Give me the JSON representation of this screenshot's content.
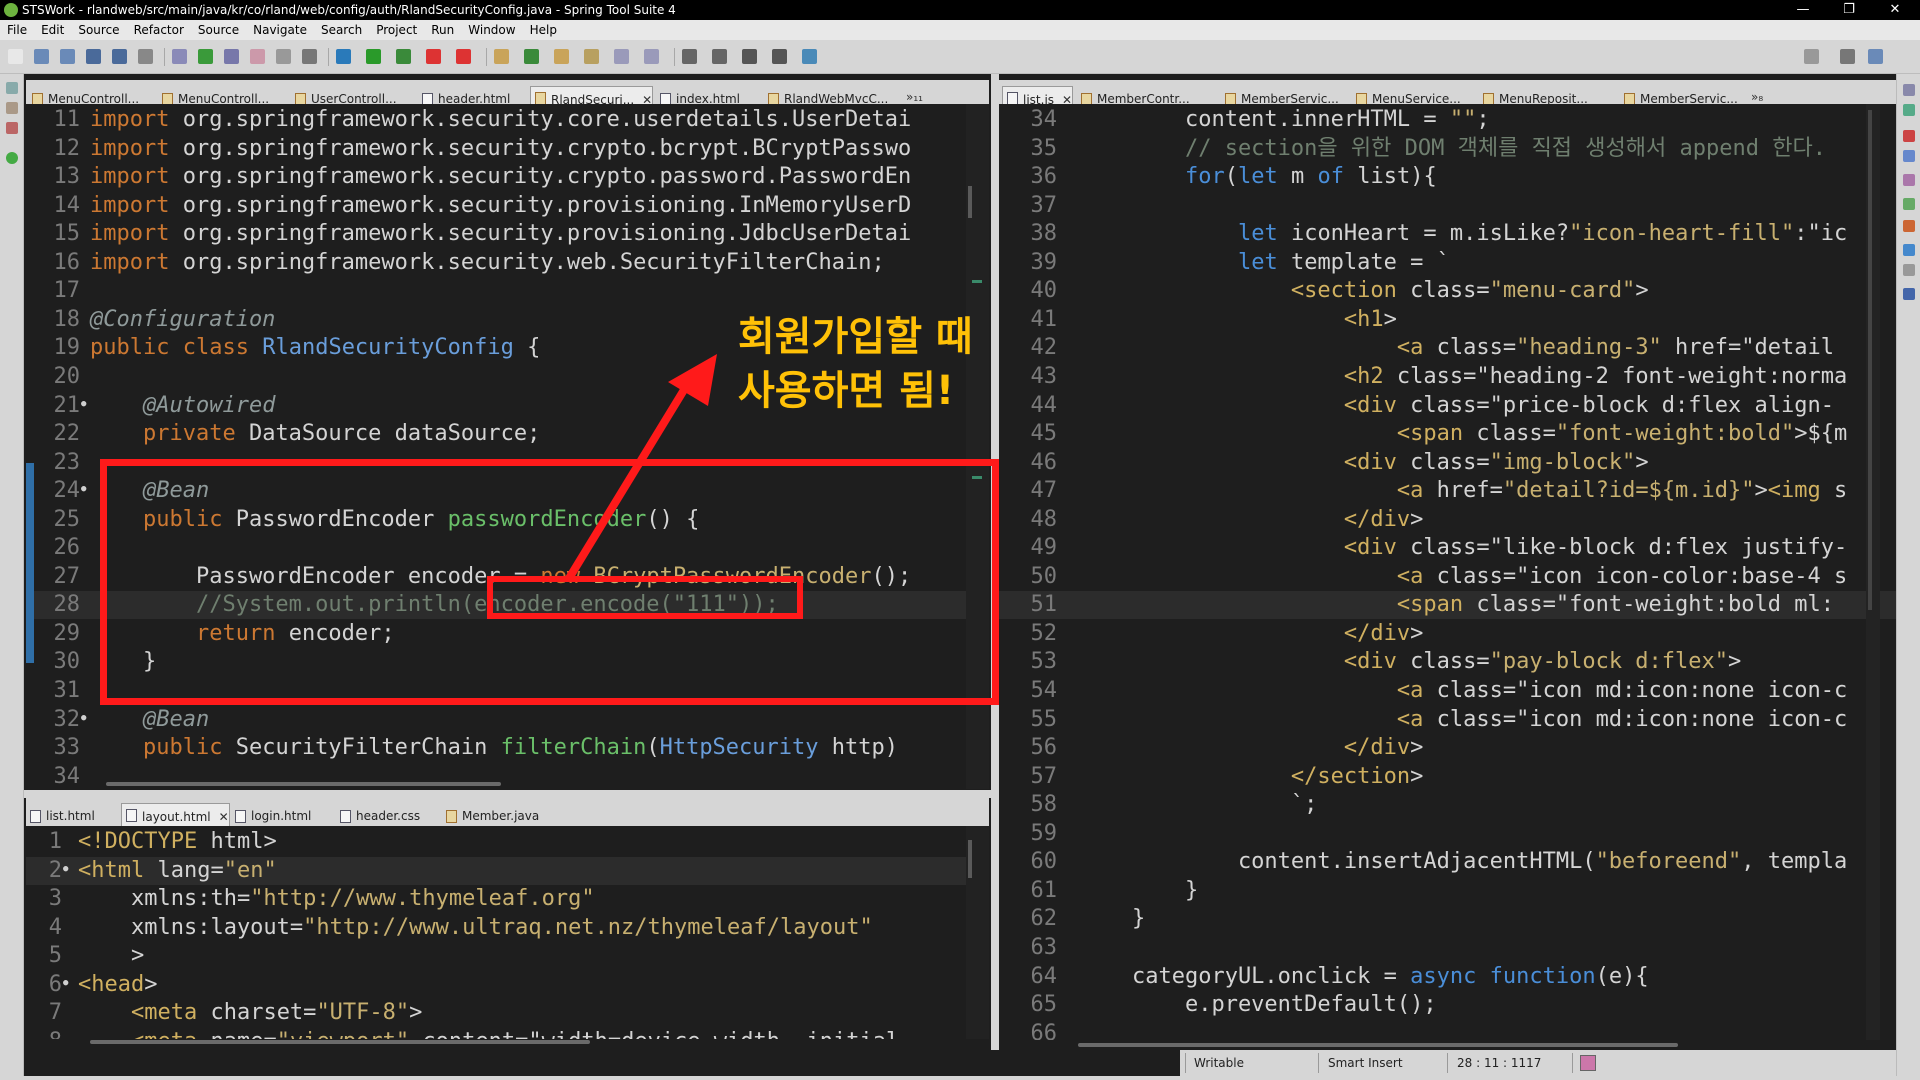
{
  "window": {
    "title": "STSWork - rlandweb/src/main/java/kr/co/rland/web/config/auth/RlandSecurityConfig.java - Spring Tool Suite 4",
    "minimize": "—",
    "restore": "❐",
    "close": "✕"
  },
  "menu": [
    "File",
    "Edit",
    "Source",
    "Refactor",
    "Source",
    "Navigate",
    "Search",
    "Project",
    "Run",
    "Window",
    "Help"
  ],
  "top_left_tabs": [
    {
      "label": "MenuControll...",
      "icon": "java-file-icon"
    },
    {
      "label": "MenuControll...",
      "icon": "java-file-icon"
    },
    {
      "label": "UserControll...",
      "icon": "java-file-icon"
    },
    {
      "label": "header.html",
      "icon": "html-file-icon"
    },
    {
      "label": "RlandSecuri...",
      "icon": "java-file-icon",
      "active": true
    },
    {
      "label": "index.html",
      "icon": "html-file-icon"
    },
    {
      "label": "RlandWebMvcC...",
      "icon": "java-file-icon"
    }
  ],
  "top_left_overflow": "»₁₁",
  "right_tabs": [
    {
      "label": "list.js",
      "icon": "js-file-icon",
      "active": true
    },
    {
      "label": "MemberContr...",
      "icon": "java-file-icon"
    },
    {
      "label": "MemberServic...",
      "icon": "java-file-icon"
    },
    {
      "label": "MenuService...",
      "icon": "java-file-icon"
    },
    {
      "label": "MenuReposit...",
      "icon": "java-file-icon"
    },
    {
      "label": "MemberServic...",
      "icon": "java-file-icon"
    }
  ],
  "right_overflow": "»₈",
  "bottom_left_tabs": [
    {
      "label": "list.html",
      "icon": "html-file-icon"
    },
    {
      "label": "layout.html",
      "icon": "html-file-icon",
      "active": true
    },
    {
      "label": "login.html",
      "icon": "html-file-icon"
    },
    {
      "label": "header.css",
      "icon": "css-file-icon"
    },
    {
      "label": "Member.java",
      "icon": "java-file-icon"
    }
  ],
  "close_glyph": "✕",
  "java_lines": [
    {
      "n": "11",
      "t": "import org.springframework.security.core.userdetails.UserDetai"
    },
    {
      "n": "12",
      "t": "import org.springframework.security.crypto.bcrypt.BCryptPasswo"
    },
    {
      "n": "13",
      "t": "import org.springframework.security.crypto.password.PasswordEn"
    },
    {
      "n": "14",
      "t": "import org.springframework.security.provisioning.InMemoryUserD"
    },
    {
      "n": "15",
      "t": "import org.springframework.security.provisioning.JdbcUserDetai"
    },
    {
      "n": "16",
      "t": "import org.springframework.security.web.SecurityFilterChain;"
    },
    {
      "n": "17",
      "t": ""
    },
    {
      "n": "18",
      "t": "@Configuration"
    },
    {
      "n": "19",
      "t": "public class RlandSecurityConfig {"
    },
    {
      "n": "20",
      "t": ""
    },
    {
      "n": "21",
      "t": "    @Autowired"
    },
    {
      "n": "22",
      "t": "    private DataSource dataSource;"
    },
    {
      "n": "23",
      "t": ""
    },
    {
      "n": "24",
      "t": "    @Bean"
    },
    {
      "n": "25",
      "t": "    public PasswordEncoder passwordEncoder() {"
    },
    {
      "n": "26",
      "t": ""
    },
    {
      "n": "27",
      "t": "        PasswordEncoder encoder = new BCryptPasswordEncoder();"
    },
    {
      "n": "28",
      "t": "        //System.out.println(encoder.encode(\"111\"));"
    },
    {
      "n": "29",
      "t": "        return encoder;"
    },
    {
      "n": "30",
      "t": "    }"
    },
    {
      "n": "31",
      "t": ""
    },
    {
      "n": "32",
      "t": "    @Bean"
    },
    {
      "n": "33",
      "t": "    public SecurityFilterChain filterChain(HttpSecurity http)"
    },
    {
      "n": "34",
      "t": ""
    }
  ],
  "html_lines": [
    {
      "n": "1",
      "t": "<!DOCTYPE html>"
    },
    {
      "n": "2",
      "t": "<html lang=\"en\""
    },
    {
      "n": "3",
      "t": "    xmlns:th=\"http://www.thymeleaf.org\""
    },
    {
      "n": "4",
      "t": "    xmlns:layout=\"http://www.ultraq.net.nz/thymeleaf/layout\""
    },
    {
      "n": "5",
      "t": "    >"
    },
    {
      "n": "6",
      "t": "<head>"
    },
    {
      "n": "7",
      "t": "    <meta charset=\"UTF-8\">"
    },
    {
      "n": "8",
      "t": "    <meta name=\"viewport\" content=\"width=device-width, initial-"
    }
  ],
  "js_lines": [
    {
      "n": "34",
      "t": "        content.innerHTML = \"\";"
    },
    {
      "n": "35",
      "t": "        // section을 위한 DOM 객체를 직접 생성해서 append 한다."
    },
    {
      "n": "36",
      "t": "        for(let m of list){"
    },
    {
      "n": "37",
      "t": ""
    },
    {
      "n": "38",
      "t": "            let iconHeart = m.isLike?\"icon-heart-fill\":\"ic"
    },
    {
      "n": "39",
      "t": "            let template = `"
    },
    {
      "n": "40",
      "t": "                <section class=\"menu-card\">"
    },
    {
      "n": "41",
      "t": "                    <h1>"
    },
    {
      "n": "42",
      "t": "                        <a class=\"heading-3\" href=\"detail"
    },
    {
      "n": "43",
      "t": "                    <h2 class=\"heading-2 font-weight:norma"
    },
    {
      "n": "44",
      "t": "                    <div class=\"price-block d:flex align-"
    },
    {
      "n": "45",
      "t": "                        <span class=\"font-weight:bold\">${m"
    },
    {
      "n": "46",
      "t": "                    <div class=\"img-block\">"
    },
    {
      "n": "47",
      "t": "                        <a href=\"detail?id=${m.id}\"><img s"
    },
    {
      "n": "48",
      "t": "                    </div>"
    },
    {
      "n": "49",
      "t": "                    <div class=\"like-block d:flex justify-"
    },
    {
      "n": "50",
      "t": "                        <a class=\"icon icon-color:base-4 s"
    },
    {
      "n": "51",
      "t": "                        <span class=\"font-weight:bold ml:"
    },
    {
      "n": "52",
      "t": "                    </div>"
    },
    {
      "n": "53",
      "t": "                    <div class=\"pay-block d:flex\">"
    },
    {
      "n": "54",
      "t": "                        <a class=\"icon md:icon:none icon-c"
    },
    {
      "n": "55",
      "t": "                        <a class=\"icon md:icon:none icon-c"
    },
    {
      "n": "56",
      "t": "                    </div>"
    },
    {
      "n": "57",
      "t": "                </section>"
    },
    {
      "n": "58",
      "t": "                `;"
    },
    {
      "n": "59",
      "t": ""
    },
    {
      "n": "60",
      "t": "            content.insertAdjacentHTML(\"beforeend\", templa"
    },
    {
      "n": "61",
      "t": "        }"
    },
    {
      "n": "62",
      "t": "    }"
    },
    {
      "n": "63",
      "t": ""
    },
    {
      "n": "64",
      "t": "    categoryUL.onclick = async function(e){"
    },
    {
      "n": "65",
      "t": "        e.preventDefault();"
    },
    {
      "n": "66",
      "t": ""
    }
  ],
  "annotation": {
    "line1": "회원가입할 때",
    "line2": "사용하면 됨!"
  },
  "status": {
    "writable": "Writable",
    "insert_mode": "Smart Insert",
    "position": "28 : 11 : 1117"
  },
  "colors": {
    "annotation_red": "#ff1a1a",
    "annotation_yellow": "#ffc107",
    "editor_bg": "#1e1e1e"
  }
}
